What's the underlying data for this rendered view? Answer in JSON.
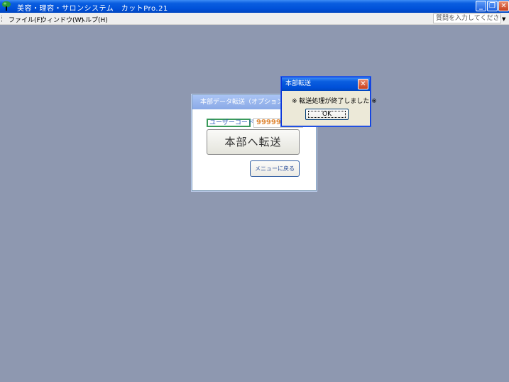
{
  "app": {
    "title": "美容・理容・サロンシステム　カットPro.21"
  },
  "menubar": {
    "items": [
      "ファイル(F)",
      "ウィンドウ(W)",
      "ヘルプ(H)"
    ],
    "help_placeholder": "質問を入力してください"
  },
  "back_dialog": {
    "title": "本部データ転送（オプション機能）",
    "user_code_label": "ユーザーコード",
    "user_code_value": "99999",
    "transfer_button": "本部へ転送",
    "return_button": "メニューに戻る"
  },
  "message_box": {
    "title": "本部転送",
    "message": "※ 転送処理が終了しました ※",
    "ok_button": "OK"
  },
  "colors": {
    "desktop": "#8e98b0",
    "titlebar": "#0050d8",
    "accent_value": "#e08a3a"
  },
  "icons": [
    "app-tree-icon",
    "minimize-icon",
    "restore-icon",
    "close-icon"
  ]
}
